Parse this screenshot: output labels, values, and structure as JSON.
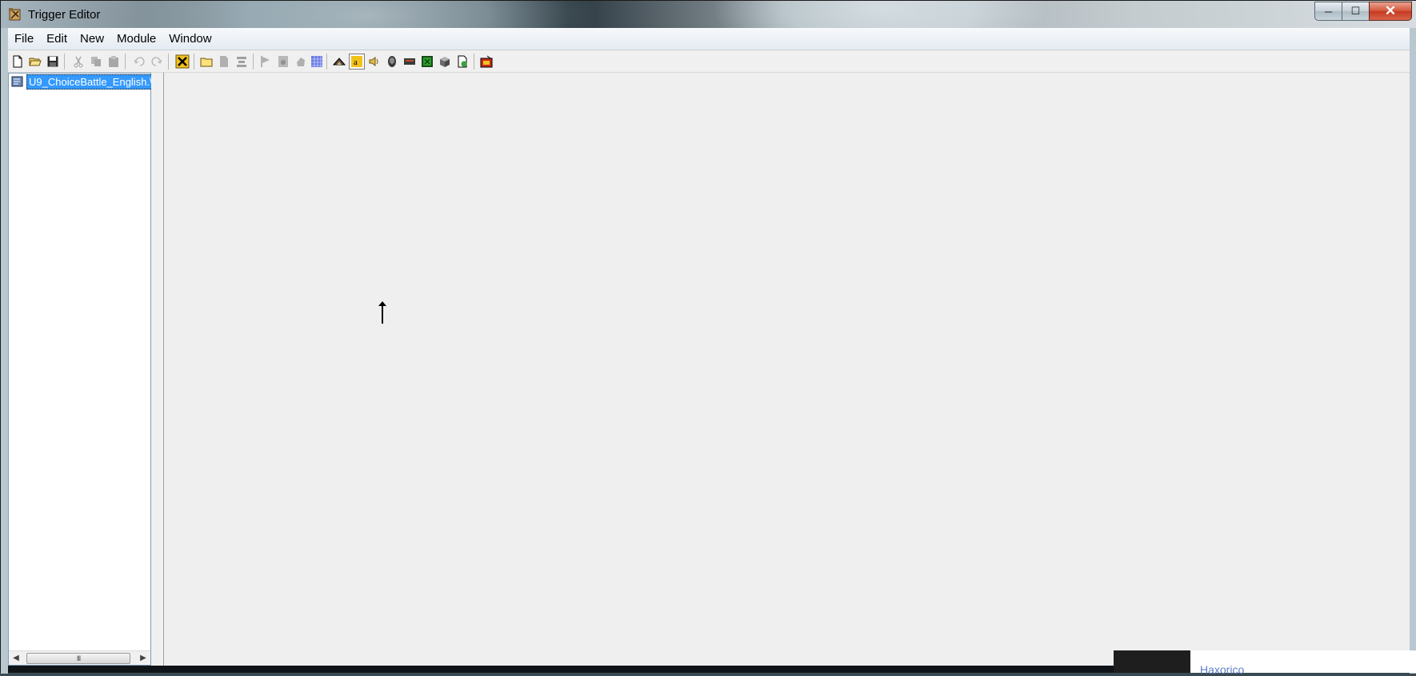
{
  "window": {
    "title": "Trigger Editor",
    "caption_buttons": {
      "minimize": "─",
      "maximize": "☐",
      "close": "✕"
    }
  },
  "menu": {
    "items": [
      "File",
      "Edit",
      "New",
      "Module",
      "Window"
    ]
  },
  "toolbar": {
    "buttons": [
      {
        "name": "new-document-icon",
        "enabled": true
      },
      {
        "name": "open-folder-icon",
        "enabled": true
      },
      {
        "name": "save-icon",
        "enabled": true
      },
      {
        "name": "cut-icon",
        "enabled": false
      },
      {
        "name": "copy-icon",
        "enabled": false
      },
      {
        "name": "paste-icon",
        "enabled": false
      },
      {
        "name": "undo-icon",
        "enabled": false
      },
      {
        "name": "redo-icon",
        "enabled": false
      },
      {
        "name": "delete-icon",
        "enabled": true
      },
      {
        "name": "new-folder-icon",
        "enabled": true
      },
      {
        "name": "new-page-icon",
        "enabled": false
      },
      {
        "name": "align-icon",
        "enabled": false
      },
      {
        "name": "flag-icon",
        "enabled": false
      },
      {
        "name": "properties-icon",
        "enabled": false
      },
      {
        "name": "hand-icon",
        "enabled": false
      },
      {
        "name": "grid-icon",
        "enabled": true
      },
      {
        "name": "terrain-icon",
        "enabled": true
      },
      {
        "name": "text-icon",
        "enabled": true
      },
      {
        "name": "sound-icon",
        "enabled": true
      },
      {
        "name": "unit-icon",
        "enabled": true
      },
      {
        "name": "keyboard-icon",
        "enabled": true
      },
      {
        "name": "minimap-icon",
        "enabled": true
      },
      {
        "name": "cube-icon",
        "enabled": true
      },
      {
        "name": "export-icon",
        "enabled": true
      },
      {
        "name": "trigger-run-icon",
        "enabled": true
      }
    ]
  },
  "tree": {
    "selected_item": "U9_ChoiceBattle_English.\\",
    "scrollbar_thumb": "III"
  },
  "overlay": {
    "text": "Haxorico"
  },
  "colors": {
    "selection": "#3399ff",
    "workspace": "#efefef",
    "menubar": "#e4ebf2",
    "close_button": "#c43a20",
    "overlay_link": "#5b7fc7"
  }
}
